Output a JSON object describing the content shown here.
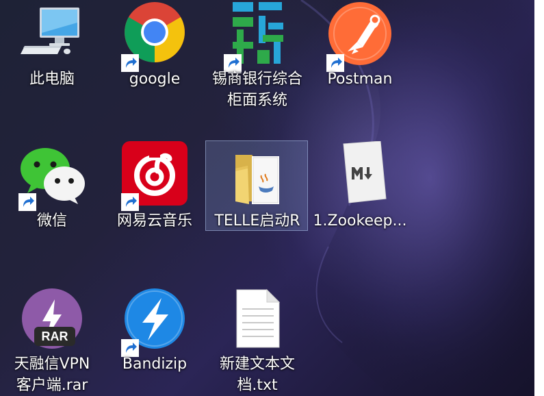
{
  "desktop": {
    "icons": [
      {
        "label": "此电脑",
        "icon": "computer-icon",
        "shortcut": false
      },
      {
        "label": "google",
        "icon": "chrome-icon",
        "shortcut": true
      },
      {
        "label": "锡商银行综合\n柜面系统",
        "icon": "xishang-bank-icon",
        "shortcut": true
      },
      {
        "label": "Postman",
        "icon": "postman-icon",
        "shortcut": true
      },
      {
        "label": "微信",
        "icon": "wechat-icon",
        "shortcut": true
      },
      {
        "label": "网易云音乐",
        "icon": "netease-music-icon",
        "shortcut": true
      },
      {
        "label": "TELLE启动R",
        "icon": "folder-icon",
        "shortcut": false,
        "selected": true
      },
      {
        "label": "1.Zookeep...",
        "icon": "markdown-file-icon",
        "shortcut": false
      },
      {
        "label": "天融信VPN\n客户端.rar",
        "icon": "winrar-archive-icon",
        "shortcut": false,
        "badge": "RAR"
      },
      {
        "label": "Bandizip",
        "icon": "bandizip-icon",
        "shortcut": true
      },
      {
        "label": "新建文本文\n档.txt",
        "icon": "text-file-icon",
        "shortcut": false
      }
    ]
  },
  "colors": {
    "selection": "#8296c8",
    "wechat": "#3fc436",
    "netease": "#d8001a",
    "postman": "#ff6c37",
    "bandizip": "#1e88e5",
    "winrar": "#8e5aa8",
    "bank_green": "#2eaa4a",
    "bank_blue": "#27a6d9"
  }
}
